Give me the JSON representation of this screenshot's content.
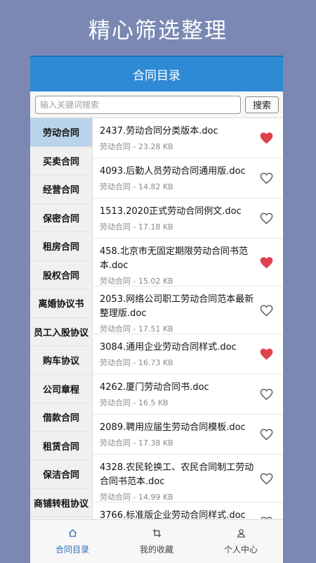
{
  "promo_title": "精心筛选整理",
  "navbar": {
    "title": "合同目录"
  },
  "search": {
    "placeholder": "输入关键词搜索",
    "button": "搜索"
  },
  "categories": [
    "劳动合同",
    "买卖合同",
    "经营合同",
    "保密合同",
    "租房合同",
    "股权合同",
    "离婚协议书",
    "员工入股协议",
    "购车协议",
    "公司章程",
    "借款合同",
    "租赁合同",
    "保洁合同",
    "商铺转租协议"
  ],
  "active_category": "劳动合同",
  "files": [
    {
      "name": "2437.劳动合同分类版本.doc",
      "meta": "劳动合同 - 23.28 KB",
      "favorited": true
    },
    {
      "name": "4093.后勤人员劳动合同通用版.doc",
      "meta": "劳动合同 - 14.82 KB",
      "favorited": false
    },
    {
      "name": "1513.2020正式劳动合同例文.doc",
      "meta": "劳动合同 - 17.18 KB",
      "favorited": false
    },
    {
      "name": "458.北京市无固定期限劳动合同书范本.doc",
      "meta": "劳动合同 - 15.02 KB",
      "favorited": true
    },
    {
      "name": "2053.网络公司职工劳动合同范本最新整理版.doc",
      "meta": "劳动合同 - 17.51 KB",
      "favorited": false
    },
    {
      "name": "3084.通用企业劳动合同样式.doc",
      "meta": "劳动合同 - 16.73 KB",
      "favorited": true
    },
    {
      "name": "4262.厦门劳动合同书.doc",
      "meta": "劳动合同 - 16.5 KB",
      "favorited": false
    },
    {
      "name": "2089.聘用应届生劳动合同模板.doc",
      "meta": "劳动合同 - 17.38 KB",
      "favorited": false
    },
    {
      "name": "4328.农民轮换工、农民合同制工劳动合同书范本.doc",
      "meta": "劳动合同 - 14.99 KB",
      "favorited": false
    },
    {
      "name": "3766.标准版企业劳动合同样式.doc",
      "meta": "",
      "favorited": false
    }
  ],
  "tabbar": {
    "tabs": [
      {
        "label": "合同目录",
        "icon": "home-icon",
        "active": true
      },
      {
        "label": "我的收藏",
        "icon": "crop-icon",
        "active": false
      },
      {
        "label": "个人中心",
        "icon": "person-icon",
        "active": false
      }
    ]
  },
  "colors": {
    "navbar": "#2f8ad5",
    "background": "#7a88b3",
    "heart": "#e0424d",
    "active_tab": "#2f6fb6"
  }
}
